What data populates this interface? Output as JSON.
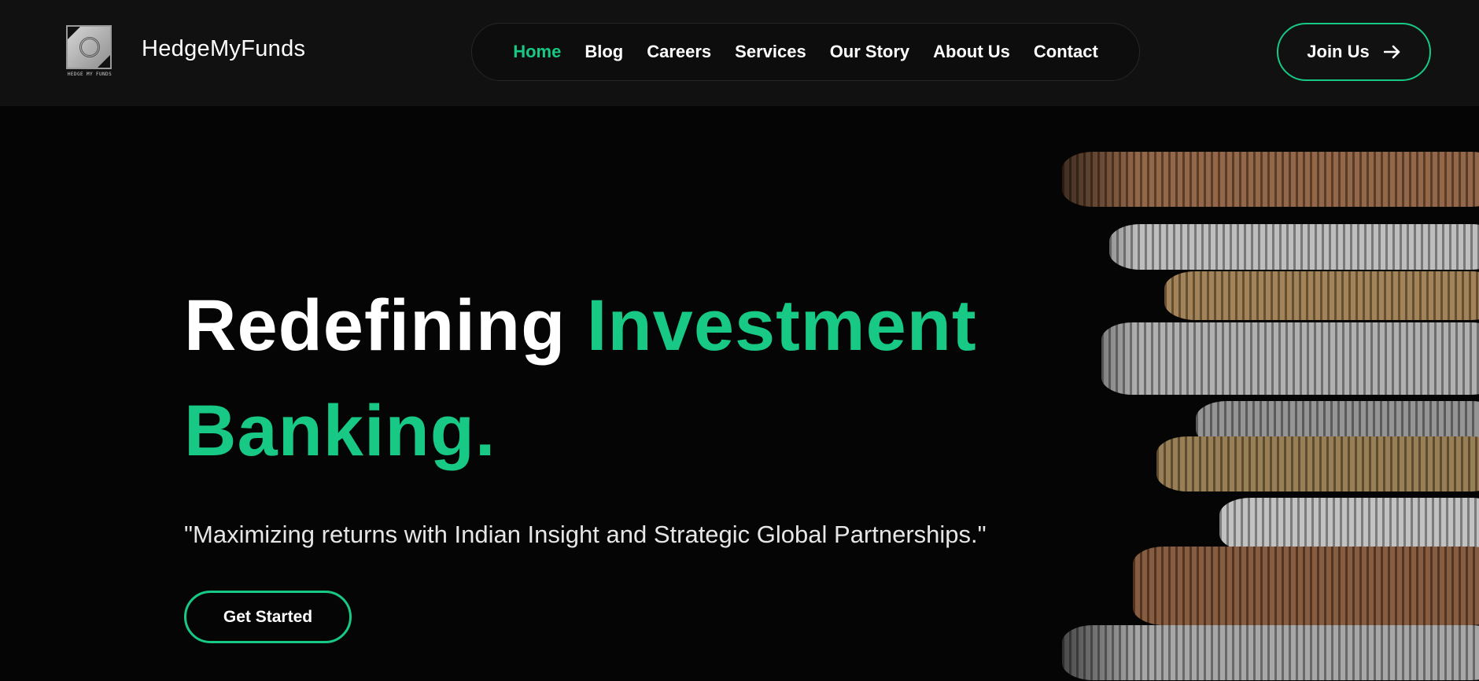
{
  "header": {
    "logo_caption": "HEDGE MY FUNDS",
    "brand_name": "HedgeMyFunds",
    "nav": [
      {
        "label": "Home",
        "active": true
      },
      {
        "label": "Blog",
        "active": false
      },
      {
        "label": "Careers",
        "active": false
      },
      {
        "label": "Services",
        "active": false
      },
      {
        "label": "Our Story",
        "active": false
      },
      {
        "label": "About Us",
        "active": false
      },
      {
        "label": "Contact",
        "active": false
      }
    ],
    "join_label": "Join Us",
    "join_icon": "arrow-right-icon"
  },
  "hero": {
    "headline_part1": "Redefining ",
    "headline_accent1": "Investment",
    "headline_accent2": "Banking.",
    "tagline": "\"Maximizing returns with Indian Insight and Strategic Global Partnerships.\"",
    "cta_label": "Get Started",
    "image": "stacked-coins-image"
  },
  "colors": {
    "accent": "#17c985",
    "header_bg": "#111111",
    "page_bg": "#050505"
  }
}
